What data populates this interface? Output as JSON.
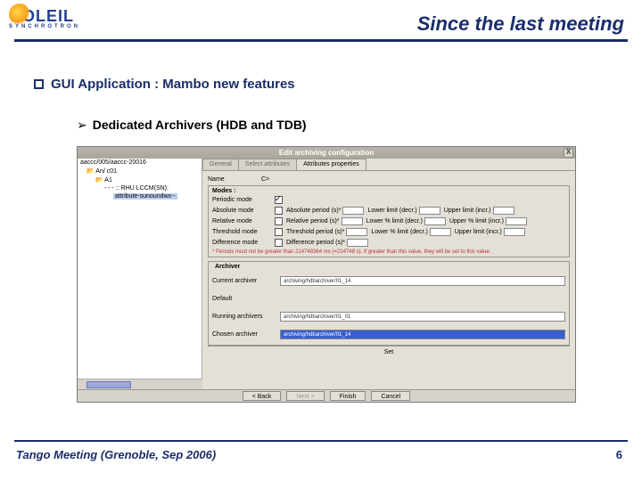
{
  "header": {
    "logo": {
      "main": "SOLEIL",
      "sub": "SYNCHROTRON"
    },
    "title": "Since the last meeting"
  },
  "bullets": {
    "b1": "GUI Application : Mambo new features",
    "b2": "Dedicated Archivers (HDB and TDB)"
  },
  "dialog": {
    "title": "Edit archiving configuration",
    "close": "X",
    "tree": {
      "root": "aaccc/005/aaccc-20016",
      "dev": "An/ c01",
      "child": "A1",
      "leaf": "- - - :: RHU LCCM(SN):",
      "attr": "attribute-sunoundwx--"
    },
    "tabs": {
      "t1": "General",
      "t2": "Select attributes",
      "t3": "Attributes properties"
    },
    "form": {
      "name_lbl": "Name",
      "name_val": "C>",
      "modes_lbl": "Modes :",
      "periodic": "Periodic mode",
      "absolute": "Absolute mode",
      "relative": "Relative mode",
      "threshold": "Threshold mode",
      "difference": "Difference mode",
      "abs_period": "Absolute period (s)*",
      "rel_period": "Relative period (s)*",
      "thr_period": "Threshold period (s)*",
      "dif_period": "Difference period (s)*",
      "lower_abs": "Lower limit (decr.)",
      "lower_rel": "Lower % limit (decr.)",
      "lower_thr": "Lower % limit (decr.)",
      "upper_abs": "Upper limit (incr.)",
      "upper_rel": "Upper % limit (incr.)",
      "upper_thr": "Upper limit (incr.)",
      "warn": "* Periods must not be greater than 214748364 ms (=214748 s). If greater than this value, they will be set to this value."
    },
    "arch": {
      "legend": "Archiver",
      "current_lbl": "Current archiver",
      "current_val": "archiving/hdbarchiver/01_14",
      "default_lbl": "Default",
      "running_lbl": "Running archivers",
      "running_val": "archiving/hdbarchiver/01_01",
      "chosen_lbl": "Chosen archiver",
      "chosen_val": "archiving/hdbarchiver/01_14"
    },
    "set": "Set",
    "nav": {
      "back": "< Back",
      "next": "Next >",
      "finish": "Finish",
      "cancel": "Cancel"
    }
  },
  "footer": {
    "left": "Tango Meeting (Grenoble, Sep 2006)",
    "page": "6"
  }
}
